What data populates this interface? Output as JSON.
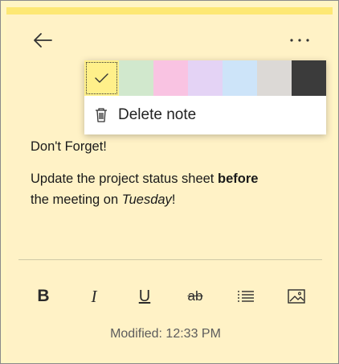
{
  "colors": {
    "window_bg": "#fff5c4",
    "top_strip": "#fde874",
    "accent_text": "#1a1a1a"
  },
  "header": {
    "back_icon": "arrow-left-icon",
    "more_icon": "more-horizontal-icon"
  },
  "popup": {
    "swatches": [
      {
        "name": "yellow",
        "color": "#fff08a",
        "selected": true
      },
      {
        "name": "green",
        "color": "#d1e8cd"
      },
      {
        "name": "pink",
        "color": "#f9c3e2"
      },
      {
        "name": "purple",
        "color": "#e4d3f5"
      },
      {
        "name": "blue",
        "color": "#cde4f9"
      },
      {
        "name": "gray",
        "color": "#dcd9d6"
      },
      {
        "name": "charcoal",
        "color": "#3b3b3b"
      }
    ],
    "delete_label": "Delete note",
    "delete_icon": "trash-icon"
  },
  "note": {
    "line1": "Don't Forget!",
    "line2_part1": "Update the project status sheet ",
    "line2_bold": "before",
    "line3_part1": "the meeting on ",
    "line3_italic": "Tuesday",
    "line3_part2": "!"
  },
  "toolbar": {
    "bold_label": "B",
    "italic_label": "I",
    "underline_label": "U",
    "strike_label": "ab",
    "list_icon": "bullet-list-icon",
    "image_icon": "image-icon"
  },
  "footer": {
    "modified_text": "Modified: 12:33 PM"
  }
}
